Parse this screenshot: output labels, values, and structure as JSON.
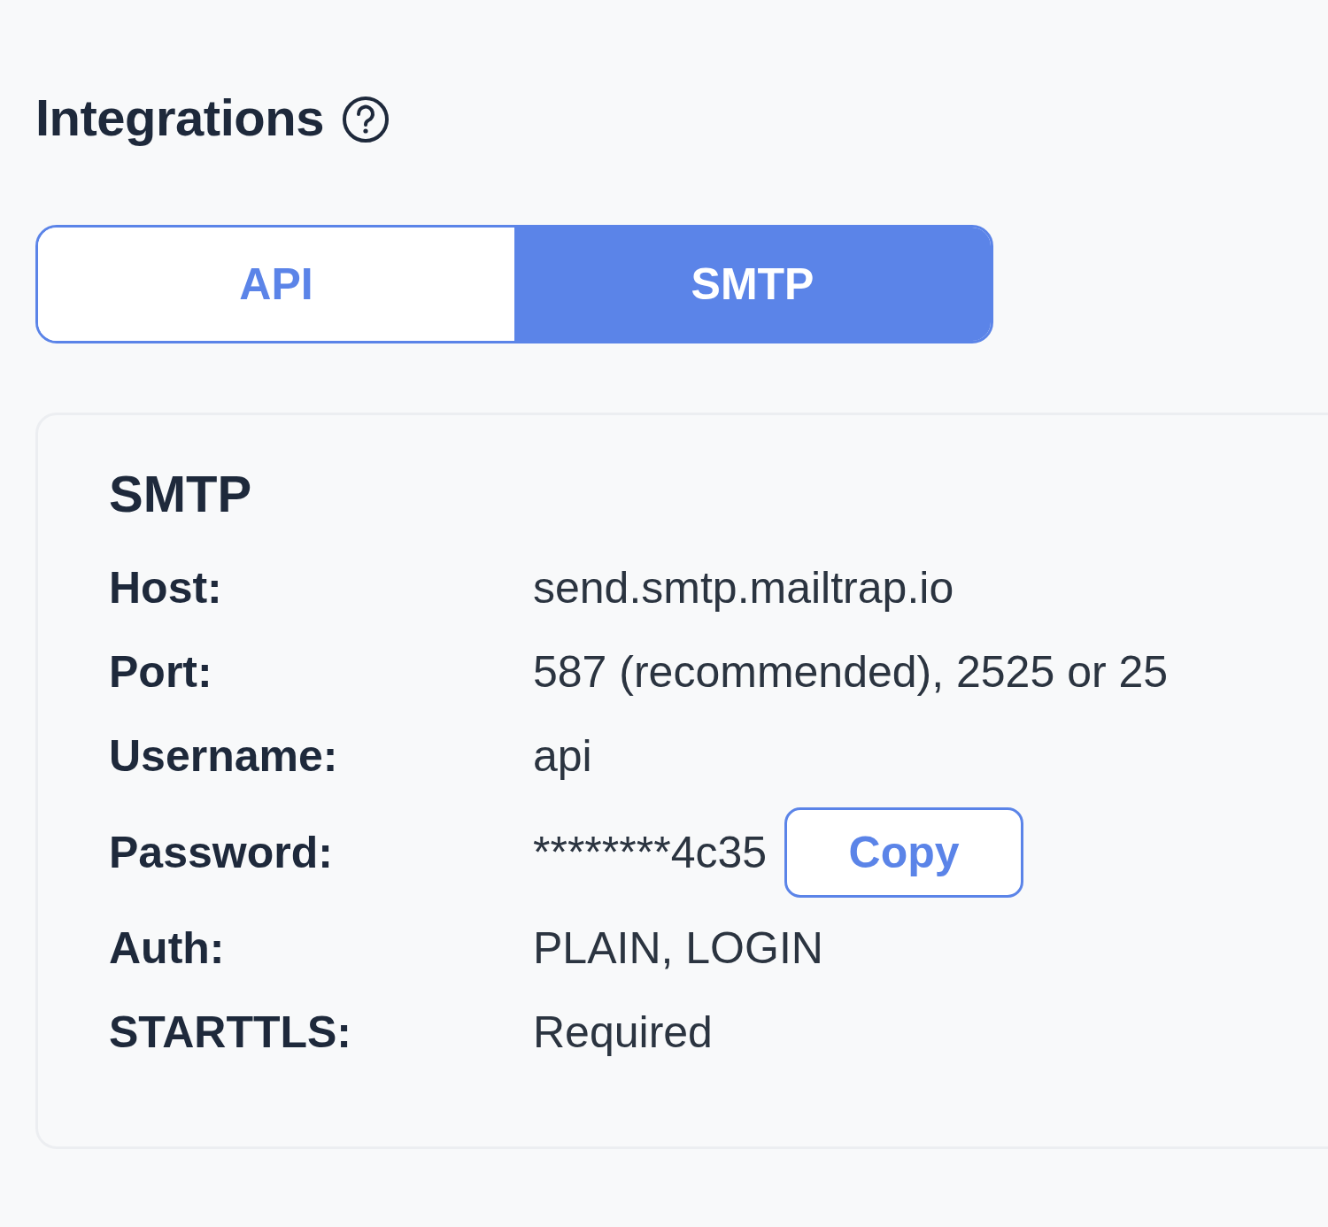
{
  "page": {
    "title": "Integrations"
  },
  "tabs": [
    {
      "label": "API",
      "selected": false
    },
    {
      "label": "SMTP",
      "selected": true
    }
  ],
  "card": {
    "title": "SMTP",
    "rows": [
      {
        "label": "Host:",
        "value": "send.smtp.mailtrap.io"
      },
      {
        "label": "Port:",
        "value": "587 (recommended), 2525 or 25"
      },
      {
        "label": "Username:",
        "value": "api"
      },
      {
        "label": "Password:",
        "value": "********4c35",
        "button": "Copy"
      },
      {
        "label": "Auth:",
        "value": "PLAIN, LOGIN"
      },
      {
        "label": "STARTTLS:",
        "value": "Required"
      }
    ]
  }
}
